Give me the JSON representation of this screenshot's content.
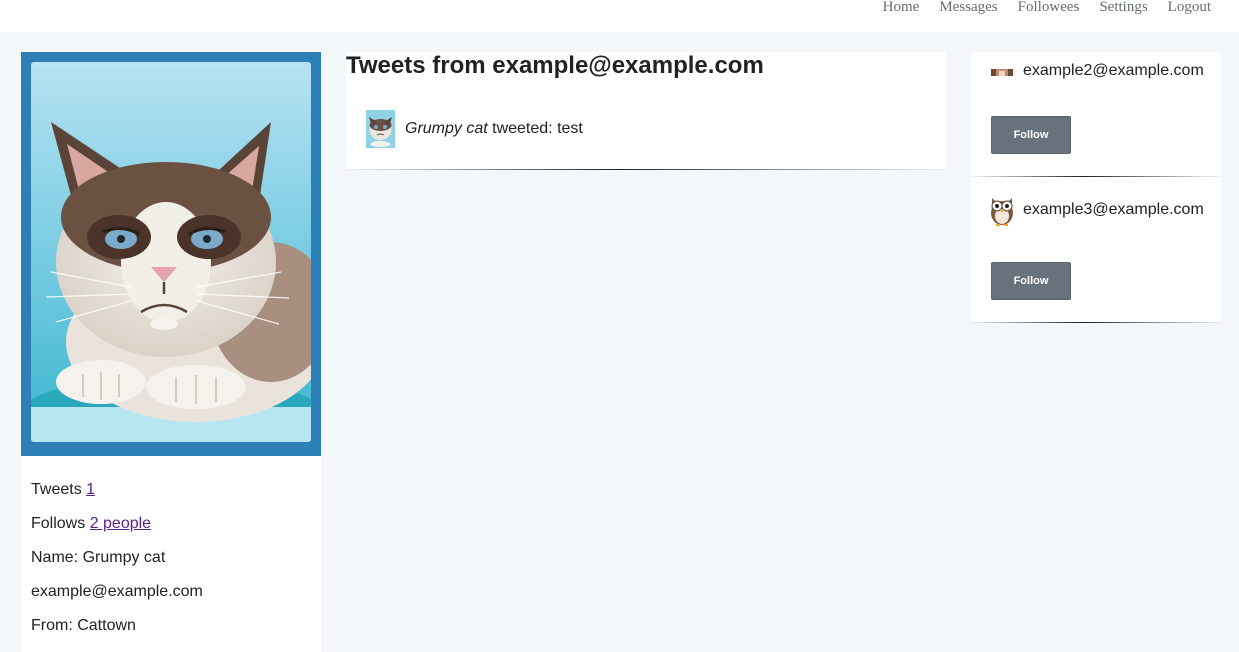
{
  "nav": {
    "items": [
      "Home",
      "Messages",
      "Followees",
      "Settings",
      "Logout"
    ]
  },
  "profile": {
    "tweets_label": "Tweets",
    "tweets_count": "1",
    "follows_label": "Follows",
    "follows_link": "2 people",
    "name_line": "Name: Grumpy cat",
    "email": "example@example.com",
    "from_line": "From: Cattown"
  },
  "tweets": {
    "title": "Tweets from example@example.com",
    "items": [
      {
        "author": "Grumpy cat",
        "verb": " tweeted: ",
        "text": "test"
      }
    ]
  },
  "suggestions": {
    "items": [
      {
        "email": "example2@example.com",
        "button": "Follow",
        "avatar_icon": "cat-avatar-icon"
      },
      {
        "email": "example3@example.com",
        "button": "Follow",
        "avatar_icon": "owl-avatar-icon"
      }
    ]
  },
  "colors": {
    "frame": "#2d7fb8",
    "button": "#67727c",
    "link_visited": "#5a1f8a",
    "background": "#f4f7fa"
  }
}
